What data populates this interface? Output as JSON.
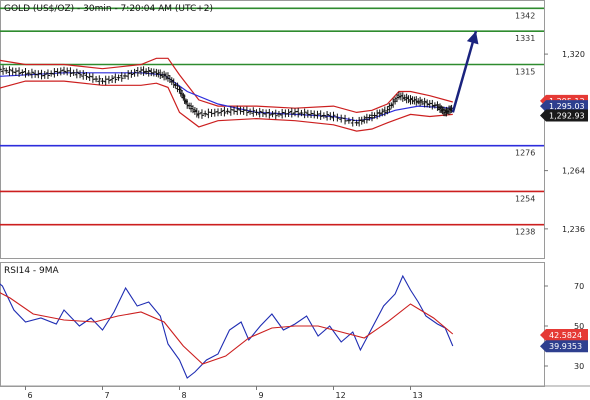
{
  "chart_data": [
    {
      "type": "line",
      "title": "GOLD (US$/OZ) - 30min - 7:20:04 AM (UTC+2)",
      "x_labels": [
        "6",
        "7",
        "8",
        "9",
        "12",
        "13"
      ],
      "y_tick_labels": [
        {
          "label": "1,320",
          "value": 1320
        },
        {
          "label": "1,264",
          "value": 1264
        },
        {
          "label": "1,236",
          "value": 1236
        }
      ],
      "ylim": [
        1222,
        1346
      ],
      "levels": [
        {
          "label": "1342",
          "value": 1342,
          "color": "#2e8b2e"
        },
        {
          "label": "1331",
          "value": 1331,
          "color": "#2e8b2e"
        },
        {
          "label": "1315",
          "value": 1315,
          "color": "#2e8b2e"
        },
        {
          "label": "1276",
          "value": 1276,
          "color": "#2d2ddc"
        },
        {
          "label": "1254",
          "value": 1254,
          "color": "#cc1f1f"
        },
        {
          "label": "1238",
          "value": 1238,
          "color": "#cc1f1f"
        }
      ],
      "price_tags": [
        {
          "label": "1,295.13",
          "value": 1297.5,
          "bg": "#e53935",
          "fg": "#ffffff"
        },
        {
          "label": "1,295.03",
          "value": 1295.0,
          "bg": "#2e3f8f",
          "fg": "#ffffff"
        },
        {
          "label": "1,292.93",
          "value": 1290.5,
          "bg": "#1a1a1a",
          "fg": "#ffffff"
        }
      ],
      "price_path": [
        [
          0,
          1314
        ],
        [
          0.25,
          1312
        ],
        [
          0.5,
          1311
        ],
        [
          0.75,
          1310
        ],
        [
          1,
          1312
        ],
        [
          1.25,
          1310
        ],
        [
          1.5,
          1307
        ],
        [
          1.75,
          1309
        ],
        [
          2,
          1312
        ],
        [
          2.2,
          1311
        ],
        [
          2.35,
          1309
        ],
        [
          2.5,
          1303
        ],
        [
          2.6,
          1296
        ],
        [
          2.75,
          1291
        ],
        [
          3,
          1292
        ],
        [
          3.25,
          1293
        ],
        [
          3.5,
          1292
        ],
        [
          3.75,
          1291
        ],
        [
          4,
          1292
        ],
        [
          4.25,
          1291
        ],
        [
          4.5,
          1290
        ],
        [
          4.8,
          1287
        ],
        [
          5,
          1290
        ],
        [
          5.2,
          1293
        ],
        [
          5.35,
          1300
        ],
        [
          5.5,
          1298
        ],
        [
          5.65,
          1297
        ],
        [
          5.85,
          1295
        ],
        [
          5.95,
          1292
        ],
        [
          6.05,
          1294
        ]
      ],
      "bollinger_upper": [
        [
          0,
          1318
        ],
        [
          0.5,
          1315
        ],
        [
          1,
          1315
        ],
        [
          1.5,
          1313
        ],
        [
          2,
          1315
        ],
        [
          2.2,
          1318
        ],
        [
          2.35,
          1318
        ],
        [
          2.5,
          1310
        ],
        [
          2.75,
          1298
        ],
        [
          3,
          1295
        ],
        [
          3.5,
          1295
        ],
        [
          4,
          1294
        ],
        [
          4.5,
          1295
        ],
        [
          4.8,
          1292
        ],
        [
          5,
          1293
        ],
        [
          5.2,
          1296
        ],
        [
          5.35,
          1302
        ],
        [
          5.5,
          1302
        ],
        [
          5.75,
          1300
        ],
        [
          6.05,
          1297
        ]
      ],
      "bollinger_lower": [
        [
          0,
          1302
        ],
        [
          0.5,
          1307
        ],
        [
          1,
          1307
        ],
        [
          1.5,
          1305
        ],
        [
          2,
          1305
        ],
        [
          2.2,
          1306
        ],
        [
          2.35,
          1304
        ],
        [
          2.5,
          1292
        ],
        [
          2.75,
          1285
        ],
        [
          3,
          1288
        ],
        [
          3.5,
          1289
        ],
        [
          4,
          1288
        ],
        [
          4.5,
          1286
        ],
        [
          4.8,
          1283
        ],
        [
          5,
          1284
        ],
        [
          5.2,
          1287
        ],
        [
          5.35,
          1289
        ],
        [
          5.5,
          1291
        ],
        [
          5.75,
          1290
        ],
        [
          6.05,
          1291
        ]
      ],
      "moving_average": [
        [
          0,
          1309
        ],
        [
          1,
          1311
        ],
        [
          2,
          1311
        ],
        [
          2.3,
          1310
        ],
        [
          2.6,
          1302
        ],
        [
          3,
          1296
        ],
        [
          3.5,
          1292
        ],
        [
          4,
          1291
        ],
        [
          4.5,
          1290
        ],
        [
          4.8,
          1288
        ],
        [
          5,
          1289
        ],
        [
          5.3,
          1293
        ],
        [
          5.6,
          1295
        ],
        [
          6.05,
          1294
        ]
      ],
      "projection_arrow": [
        [
          6.05,
          1292
        ],
        [
          6.35,
          1331
        ]
      ]
    },
    {
      "type": "line",
      "title": "RSI14 - 9MA",
      "y_tick_labels": [
        {
          "label": "70",
          "value": 70
        },
        {
          "label": "50",
          "value": 50
        },
        {
          "label": "30",
          "value": 30
        }
      ],
      "ylim": [
        20,
        82
      ],
      "value_tags": [
        {
          "label": "42.5824",
          "value": 45.5,
          "bg": "#e53935",
          "fg": "#ffffff"
        },
        {
          "label": "39.9353",
          "value": 39.9,
          "bg": "#2e3f8f",
          "fg": "#ffffff"
        }
      ],
      "series": [
        {
          "name": "RSI14",
          "color": "#1f2db3",
          "values": [
            [
              0,
              76
            ],
            [
              0.2,
              70
            ],
            [
              0.35,
              58
            ],
            [
              0.5,
              52
            ],
            [
              0.7,
              54
            ],
            [
              0.9,
              51
            ],
            [
              1.0,
              58
            ],
            [
              1.2,
              50
            ],
            [
              1.35,
              54
            ],
            [
              1.5,
              48
            ],
            [
              1.65,
              57
            ],
            [
              1.8,
              69
            ],
            [
              1.95,
              60
            ],
            [
              2.1,
              62
            ],
            [
              2.25,
              55
            ],
            [
              2.35,
              41
            ],
            [
              2.5,
              33
            ],
            [
              2.6,
              24
            ],
            [
              2.7,
              27
            ],
            [
              2.85,
              33
            ],
            [
              3.0,
              36
            ],
            [
              3.15,
              48
            ],
            [
              3.3,
              52
            ],
            [
              3.4,
              43
            ],
            [
              3.55,
              50
            ],
            [
              3.7,
              56
            ],
            [
              3.85,
              48
            ],
            [
              4.0,
              51
            ],
            [
              4.15,
              55
            ],
            [
              4.3,
              45
            ],
            [
              4.45,
              50
            ],
            [
              4.6,
              42
            ],
            [
              4.75,
              47
            ],
            [
              4.85,
              38
            ],
            [
              5.0,
              49
            ],
            [
              5.15,
              60
            ],
            [
              5.3,
              66
            ],
            [
              5.4,
              75
            ],
            [
              5.5,
              68
            ],
            [
              5.6,
              62
            ],
            [
              5.7,
              55
            ],
            [
              5.85,
              51
            ],
            [
              5.95,
              49
            ],
            [
              6.05,
              40
            ]
          ]
        },
        {
          "name": "9MA",
          "color": "#cc1f1f",
          "values": [
            [
              0,
              70
            ],
            [
              0.3,
              64
            ],
            [
              0.6,
              56
            ],
            [
              1.0,
              53
            ],
            [
              1.4,
              52
            ],
            [
              1.7,
              55
            ],
            [
              2.0,
              57
            ],
            [
              2.3,
              52
            ],
            [
              2.55,
              40
            ],
            [
              2.8,
              31
            ],
            [
              3.1,
              35
            ],
            [
              3.4,
              44
            ],
            [
              3.7,
              49
            ],
            [
              4.0,
              50
            ],
            [
              4.3,
              50
            ],
            [
              4.6,
              47
            ],
            [
              4.9,
              44
            ],
            [
              5.2,
              52
            ],
            [
              5.5,
              61
            ],
            [
              5.8,
              54
            ],
            [
              6.05,
              46
            ]
          ]
        }
      ]
    }
  ]
}
